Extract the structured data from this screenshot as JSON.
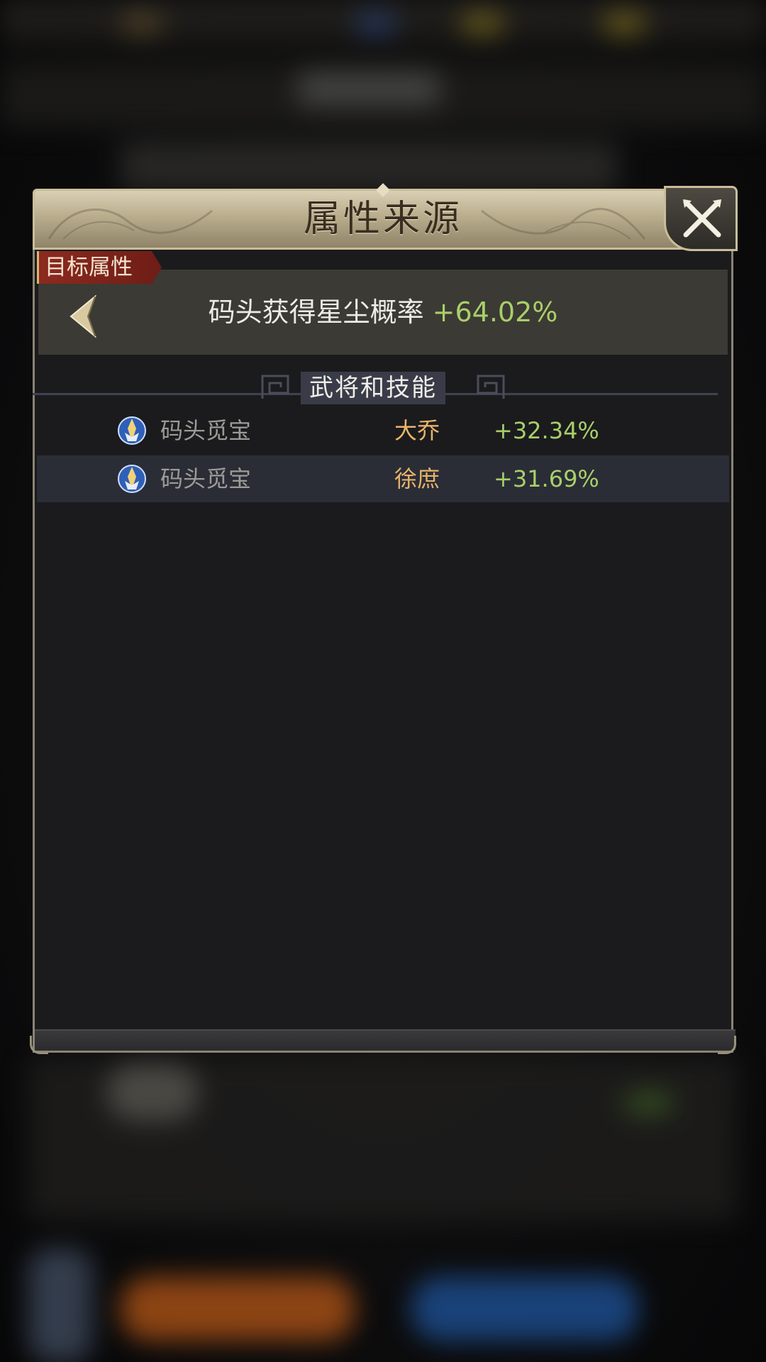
{
  "dialog": {
    "title": "属性来源",
    "close_icon": "close-x-icon"
  },
  "target": {
    "tag": "目标属性",
    "attribute": "码头获得星尘概率",
    "value": "+64.02%",
    "back_icon": "chevron-left-icon"
  },
  "section": {
    "label": "武将和技能"
  },
  "sources": [
    {
      "icon": "skill-badge-icon",
      "skill": "码头觅宝",
      "hero": "大乔",
      "value": "+32.34%"
    },
    {
      "icon": "skill-badge-icon",
      "skill": "码头觅宝",
      "hero": "徐庶",
      "value": "+31.69%"
    }
  ],
  "colors": {
    "positive_value": "#a9cf6a",
    "hero_name": "#e8b46a",
    "title_gold": "#c9bd9a",
    "tag_red": "#8c2a1f"
  }
}
